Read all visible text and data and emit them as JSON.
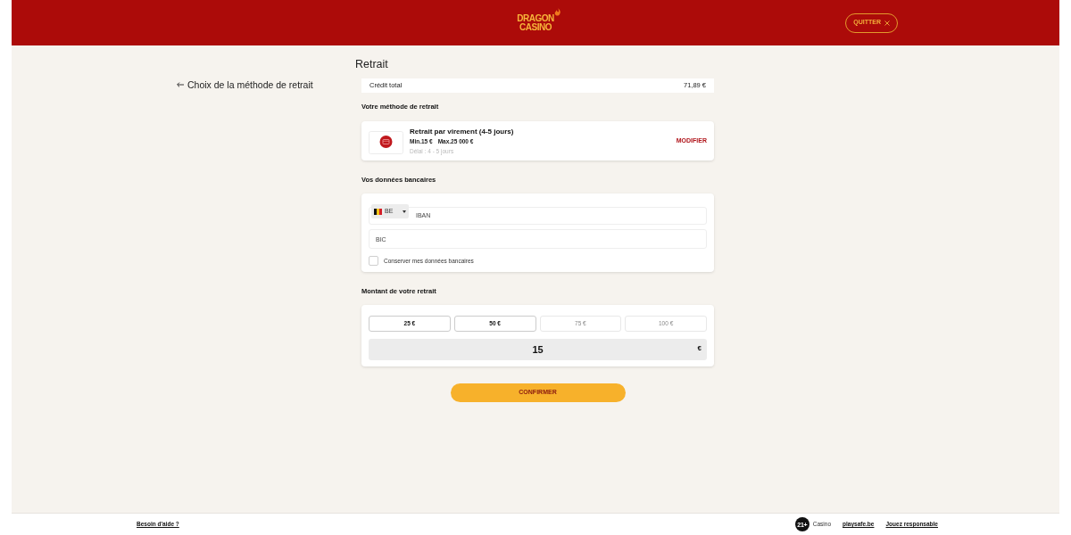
{
  "header": {
    "logo": {
      "lines": [
        "DRAGON",
        "CASINO"
      ]
    },
    "quit_button": {
      "label": "QUITTER"
    }
  },
  "back_link": {
    "label": "Choix de la méthode de retrait"
  },
  "page_title": "Retrait",
  "credit": {
    "label": "Crédit total",
    "value": "71,89 €"
  },
  "method_section": {
    "heading": "Votre méthode de retrait",
    "method": {
      "title": "Retrait par virement (4-5 jours)",
      "min": "Min.15 €",
      "max": "Max.25 000 €",
      "delay": "Délai : 4 - 5 jours",
      "action": "MODIFIER"
    }
  },
  "bank_section": {
    "heading": "Vos données bancaires",
    "iban": {
      "country": "BE",
      "placeholder": "IBAN"
    },
    "bic": {
      "placeholder": "BIC"
    },
    "remember": {
      "label": "Conserver mes données bancaires",
      "checked": false
    }
  },
  "amount_section": {
    "heading": "Montant de votre retrait",
    "presets": [
      {
        "label": "25 €",
        "disabled": false
      },
      {
        "label": "50 €",
        "disabled": false
      },
      {
        "label": "75 €",
        "disabled": true
      },
      {
        "label": "100 €",
        "disabled": true
      }
    ],
    "amount": {
      "value": "15",
      "currency": "€"
    }
  },
  "confirm_button": {
    "label": "CONFIRMER"
  },
  "footer": {
    "help_link": "Besoin d'aide ?",
    "age_badge": "21+",
    "casino_label": "Casino",
    "links": [
      "playsafe.be",
      "Jouez responsable"
    ]
  }
}
